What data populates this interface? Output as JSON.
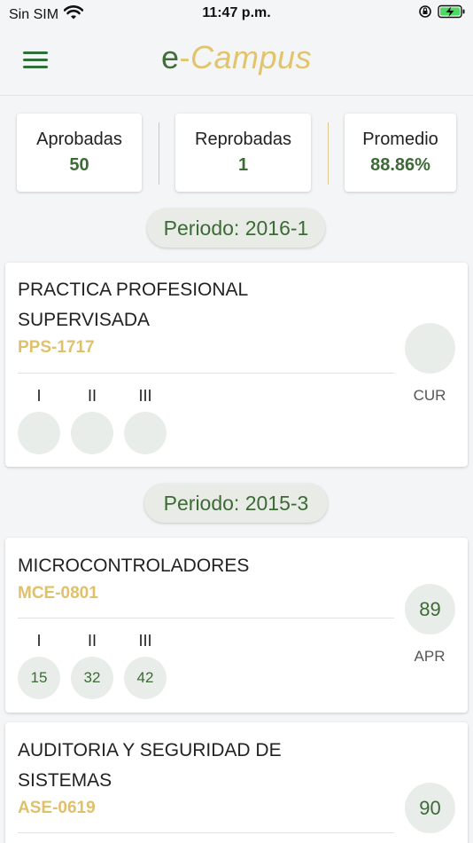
{
  "status_bar": {
    "carrier": "Sin SIM",
    "time": "11:47 p.m."
  },
  "app": {
    "title_e": "e",
    "title_dash": "-",
    "title_campus": "Campus"
  },
  "stats": [
    {
      "label": "Aprobadas",
      "value": "50"
    },
    {
      "label": "Reprobadas",
      "value": "1"
    },
    {
      "label": "Promedio",
      "value": "88.86%"
    }
  ],
  "periods": [
    {
      "label": "Periodo: 2016-1",
      "courses": [
        {
          "name_lines": [
            "PRACTICA PROFESIONAL",
            "SUPERVISADA"
          ],
          "code": "PPS-1717",
          "partials": [
            {
              "label": "I",
              "score": ""
            },
            {
              "label": "II",
              "score": ""
            },
            {
              "label": "III",
              "score": ""
            }
          ],
          "grade": "",
          "status": "CUR"
        }
      ]
    },
    {
      "label": "Periodo: 2015-3",
      "courses": [
        {
          "name_lines": [
            "MICROCONTROLADORES"
          ],
          "code": "MCE-0801",
          "partials": [
            {
              "label": "I",
              "score": "15"
            },
            {
              "label": "II",
              "score": "32"
            },
            {
              "label": "III",
              "score": "42"
            }
          ],
          "grade": "89",
          "status": "APR"
        },
        {
          "name_lines": [
            "AUDITORIA Y SEGURIDAD DE",
            "SISTEMAS"
          ],
          "code": "ASE-0619",
          "partials": [],
          "grade": "90",
          "status": ""
        }
      ]
    }
  ],
  "icons": {
    "menu": "hamburger-menu-icon",
    "wifi": "wifi-icon",
    "orientation_lock": "orientation-lock-icon",
    "battery": "battery-charging-icon"
  },
  "colors": {
    "accent_green": "#3c6b36",
    "accent_gold": "#e0c16b",
    "battery": "#4cd964"
  }
}
